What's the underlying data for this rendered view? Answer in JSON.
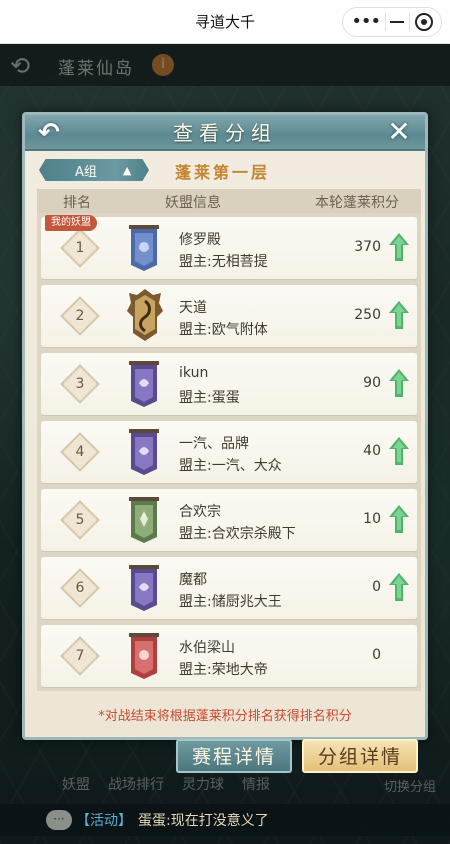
{
  "app": {
    "title": "寻道大千"
  },
  "background": {
    "map_title": "蓬莱仙岛",
    "info_badge": "i",
    "bottom_tabs": [
      "妖盟",
      "战场排行",
      "灵力球",
      "情报"
    ],
    "bottom_right": "切换分组",
    "chat_icon": "···",
    "chat_tag": "【活动】",
    "chat_message": "蛋蛋:现在打没意义了"
  },
  "modal": {
    "title": "查看分组",
    "back_icon": "arrow-back-icon",
    "close_icon": "close-icon",
    "group_select": {
      "label": "A组",
      "arrow": "▲"
    },
    "floor_name": "蓬莱第一层",
    "columns": {
      "rank": "排名",
      "info": "妖盟信息",
      "score": "本轮蓬莱积分"
    },
    "my_badge": "我的妖盟",
    "rows": [
      {
        "rank": "1",
        "name": "修罗殿",
        "leader": "盟主:无相菩提",
        "score": "370",
        "trend": "up",
        "emblem": "blue",
        "mine": true
      },
      {
        "rank": "2",
        "name": "天道",
        "leader": "盟主:欧气附体",
        "score": "250",
        "trend": "up",
        "emblem": "gold-crest",
        "mine": false
      },
      {
        "rank": "3",
        "name": "ikun",
        "leader": "盟主:蛋蛋",
        "score": "90",
        "trend": "up",
        "emblem": "purple",
        "mine": false
      },
      {
        "rank": "4",
        "name": "一汽、品牌",
        "leader": "盟主:一汽、大众",
        "score": "40",
        "trend": "up",
        "emblem": "purple",
        "mine": false
      },
      {
        "rank": "5",
        "name": "合欢宗",
        "leader": "盟主:合欢宗杀殿下",
        "score": "10",
        "trend": "up",
        "emblem": "green",
        "mine": false
      },
      {
        "rank": "6",
        "name": "魔都",
        "leader": "盟主:储厨兆大王",
        "score": "0",
        "trend": "up",
        "emblem": "purple",
        "mine": false
      },
      {
        "rank": "7",
        "name": "水伯梁山",
        "leader": "盟主:荣地大帝",
        "score": "0",
        "trend": "none",
        "emblem": "red",
        "mine": false
      }
    ],
    "footnote": "*对战结束将根据蓬莱积分排名获得排名积分"
  },
  "buttons": {
    "schedule": "赛程详情",
    "group_detail": "分组详情"
  },
  "colors": {
    "accent_teal": "#5c8a92",
    "up_green": "#4fb56a",
    "footnote_red": "#c84a30",
    "floor_gold": "#c3862f"
  }
}
